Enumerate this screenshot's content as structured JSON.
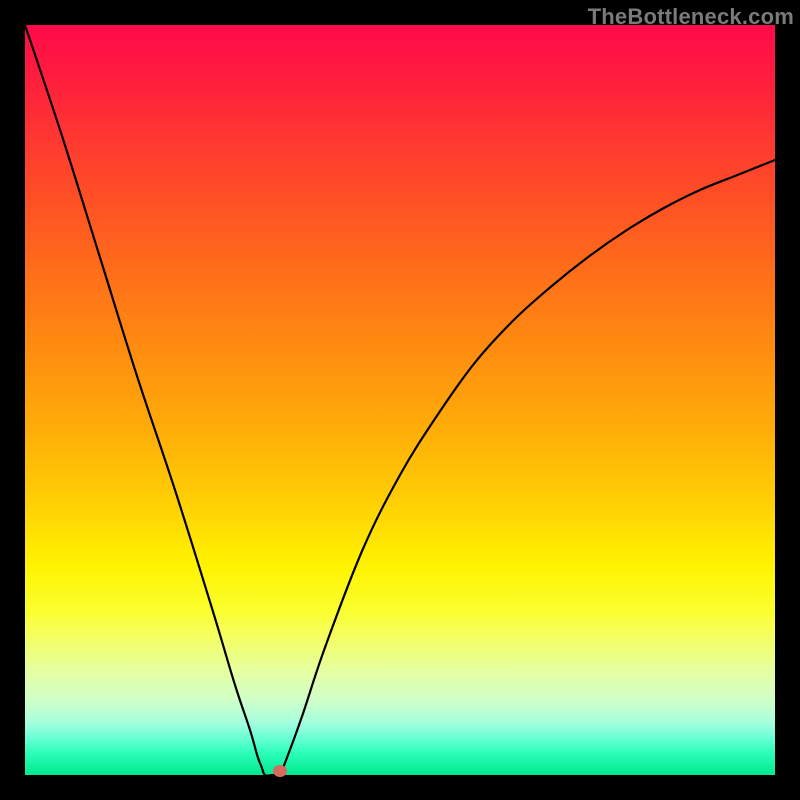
{
  "watermark": "TheBottleneck.com",
  "chart_data": {
    "type": "line",
    "title": "",
    "xlabel": "",
    "ylabel": "",
    "xlim": [
      0,
      100
    ],
    "ylim": [
      0,
      100
    ],
    "grid": false,
    "series": [
      {
        "name": "curve",
        "x": [
          0,
          5,
          10,
          15,
          20,
          25,
          28,
          30,
          31,
          31.5,
          32,
          33,
          34,
          35,
          37,
          40,
          45,
          50,
          55,
          60,
          65,
          70,
          75,
          80,
          85,
          90,
          95,
          100
        ],
        "y": [
          100,
          85,
          69,
          53,
          38,
          22,
          12,
          6,
          2.5,
          1.2,
          0,
          0,
          0.2,
          2.5,
          8,
          17,
          30,
          40,
          48,
          55,
          60.5,
          65,
          69,
          72.5,
          75.5,
          78,
          80,
          82
        ]
      }
    ],
    "marker": {
      "x": 34,
      "y": 0.5
    },
    "gradient_stops": [
      {
        "pos": 0,
        "color": "#ff0a4a"
      },
      {
        "pos": 6,
        "color": "#ff1a3f"
      },
      {
        "pos": 14,
        "color": "#ff3432"
      },
      {
        "pos": 24,
        "color": "#ff5224"
      },
      {
        "pos": 34,
        "color": "#ff7118"
      },
      {
        "pos": 44,
        "color": "#ff8f0f"
      },
      {
        "pos": 54,
        "color": "#ffad08"
      },
      {
        "pos": 64,
        "color": "#ffd104"
      },
      {
        "pos": 72,
        "color": "#fff300"
      },
      {
        "pos": 78,
        "color": "#fbff2d"
      },
      {
        "pos": 82,
        "color": "#f3ff68"
      },
      {
        "pos": 86,
        "color": "#e6ffa0"
      },
      {
        "pos": 90,
        "color": "#d0ffc8"
      },
      {
        "pos": 93,
        "color": "#a5ffdf"
      },
      {
        "pos": 95,
        "color": "#6bffd4"
      },
      {
        "pos": 97,
        "color": "#2dffba"
      },
      {
        "pos": 100,
        "color": "#00e98f"
      }
    ]
  }
}
